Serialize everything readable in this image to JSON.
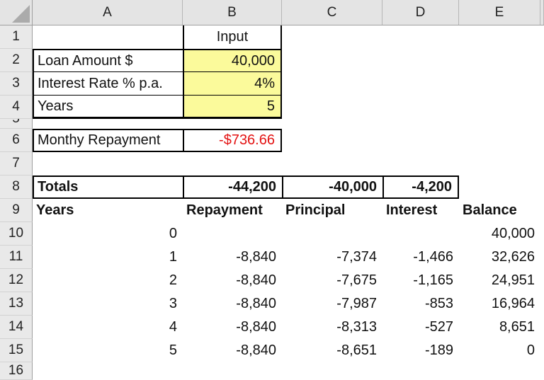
{
  "sheet": {
    "column_headers": [
      "A",
      "B",
      "C",
      "D",
      "E"
    ],
    "row_headers": [
      "1",
      "2",
      "3",
      "4",
      "5",
      "6",
      "7",
      "8",
      "9",
      "10",
      "11",
      "12",
      "13",
      "14",
      "15",
      "16"
    ],
    "colors": {
      "input_fill": "#fbfa9b",
      "negative_red": "#e31212",
      "header_bg": "#e4e4e4"
    },
    "input_section": {
      "title": "Input",
      "rows": [
        {
          "label": "Loan Amount $",
          "value": "40,000"
        },
        {
          "label": "Interest Rate % p.a.",
          "value": "4%"
        },
        {
          "label": "Years",
          "value": "5"
        }
      ]
    },
    "repayment_row": {
      "label": "Monthy Repayment",
      "value": "-$736.66"
    },
    "totals_row": {
      "label": "Totals",
      "repayment": "-44,200",
      "principal": "-40,000",
      "interest": "-4,200"
    },
    "table": {
      "headers": {
        "years": "Years",
        "repayment": "Repayment",
        "principal": "Principal",
        "interest": "Interest",
        "balance": "Balance"
      },
      "rows": [
        {
          "year": "0",
          "repayment": "",
          "principal": "",
          "interest": "",
          "balance": "40,000"
        },
        {
          "year": "1",
          "repayment": "-8,840",
          "principal": "-7,374",
          "interest": "-1,466",
          "balance": "32,626"
        },
        {
          "year": "2",
          "repayment": "-8,840",
          "principal": "-7,675",
          "interest": "-1,165",
          "balance": "24,951"
        },
        {
          "year": "3",
          "repayment": "-8,840",
          "principal": "-7,987",
          "interest": "-853",
          "balance": "16,964"
        },
        {
          "year": "4",
          "repayment": "-8,840",
          "principal": "-8,313",
          "interest": "-527",
          "balance": "8,651"
        },
        {
          "year": "5",
          "repayment": "-8,840",
          "principal": "-8,651",
          "interest": "-189",
          "balance": "0"
        }
      ]
    }
  }
}
